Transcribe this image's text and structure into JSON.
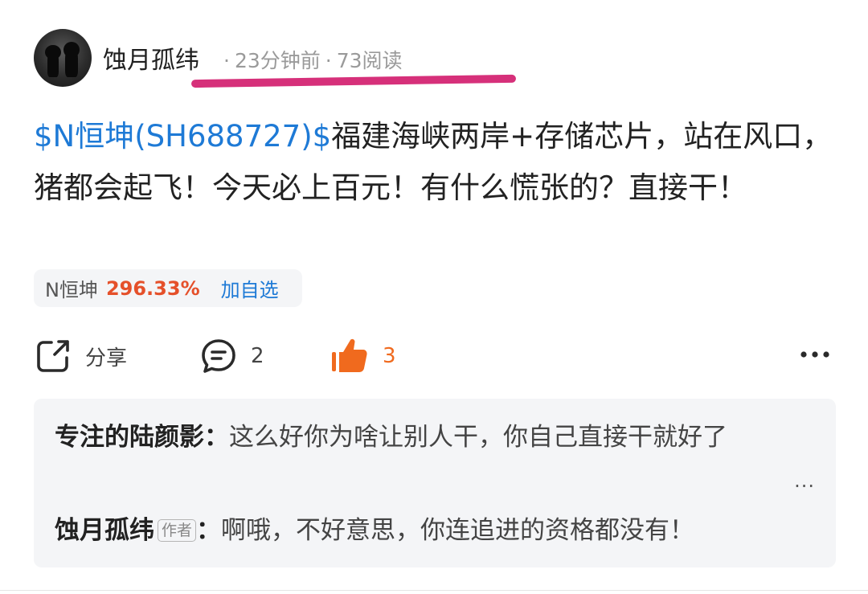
{
  "post": {
    "author": "蚀月孤纬",
    "time": "23分钟前",
    "reads": "73阅读",
    "separator": "·",
    "stock_link": "$N恒坤(SH688727)$",
    "text": "福建海峡两岸+存储芯片，站在风口，猪都会起飞！今天必上百元！有什么慌张的？直接干！"
  },
  "annotation": {
    "underline_color": "#d6307a"
  },
  "quote": {
    "name": "N恒坤",
    "change": "296.33%",
    "add_label": "加自选",
    "change_color": "#e5502a"
  },
  "actions": {
    "share_label": "分享",
    "comment_count": "2",
    "like_count": "3",
    "like_color": "#f06a1e"
  },
  "comments": [
    {
      "user": "专注的陆颜影",
      "colon": "：",
      "text": "这么好你为啥让别人干，你自己直接干就好了"
    },
    {
      "user": "蚀月孤纬",
      "tag": "作者",
      "colon": "：",
      "text": "啊哦，不好意思，你连追进的资格都没有！"
    }
  ],
  "comments_more": "...",
  "icons": [
    "avatar",
    "share-icon",
    "comment-icon",
    "thumbs-up-icon",
    "more-icon"
  ]
}
